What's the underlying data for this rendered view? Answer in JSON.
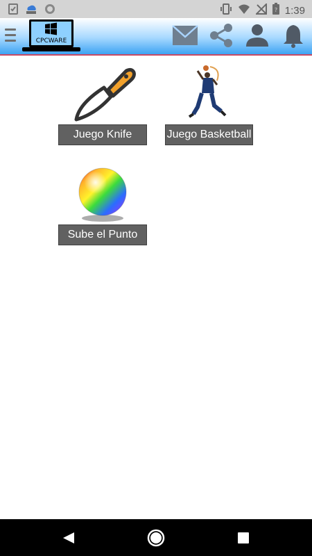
{
  "status_bar": {
    "time": "1:39",
    "left_icons": [
      "checklist-icon",
      "cloud-icon",
      "circle-icon"
    ],
    "right_icons": [
      "vibrate-icon",
      "wifi-icon",
      "no-signal-icon",
      "battery-icon"
    ]
  },
  "app_bar": {
    "logo_text": "CPCWARE",
    "actions": [
      "mail-icon",
      "share-icon",
      "account-icon",
      "notification-bell-icon"
    ],
    "colors": {
      "gradient_top": "#ffffff",
      "gradient_bottom": "#3da3f3",
      "underline": "#c94a63"
    }
  },
  "games": [
    {
      "label": "Juego Knife",
      "icon": "knife-icon"
    },
    {
      "label": "Juego Basketball",
      "icon": "basketball-player-icon"
    },
    {
      "label": "Sube el Punto",
      "icon": "rainbow-ball-icon"
    }
  ],
  "nav_bar": {
    "buttons": [
      "back-button",
      "home-button",
      "recents-button"
    ]
  }
}
